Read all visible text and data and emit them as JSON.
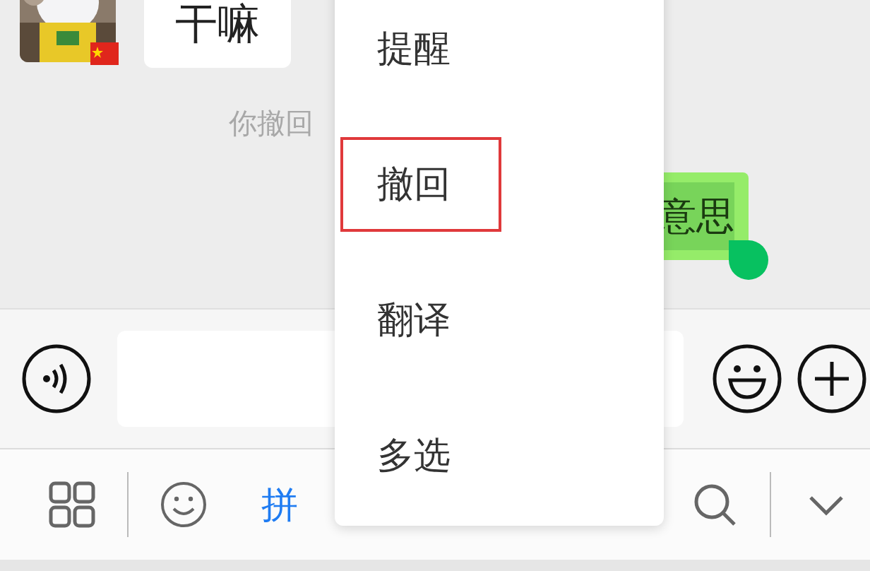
{
  "chat": {
    "messages": [
      {
        "kind": "incoming",
        "text": "干嘛"
      },
      {
        "kind": "notice",
        "text": "你撤回"
      },
      {
        "kind": "outgoing",
        "text": "意思",
        "selected": true
      }
    ]
  },
  "keyboard_toolbar": {
    "mode_label": "拼"
  },
  "context_menu": {
    "items": [
      {
        "label": "提醒",
        "selected": false
      },
      {
        "label": "撤回",
        "selected": true
      },
      {
        "label": "翻译",
        "selected": false
      },
      {
        "label": "多选",
        "selected": false
      }
    ]
  }
}
